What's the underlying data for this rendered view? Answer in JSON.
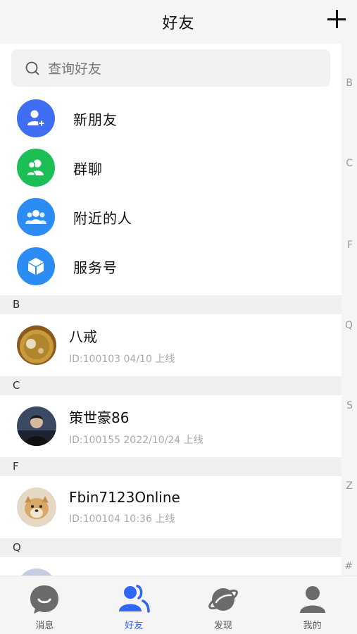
{
  "header": {
    "title": "好友"
  },
  "search": {
    "placeholder": "查询好友"
  },
  "features": [
    {
      "label": "新朋友",
      "color": "#3f6ef2",
      "icon": "add-user-icon"
    },
    {
      "label": "群聊",
      "color": "#1cbf55",
      "icon": "group-icon"
    },
    {
      "label": "附近的人",
      "color": "#2c8cf3",
      "icon": "nearby-people-icon"
    },
    {
      "label": "服务号",
      "color": "#2c8cf3",
      "icon": "cube-icon"
    }
  ],
  "sections": [
    {
      "letter": "B",
      "friend": {
        "name": "八戒",
        "meta": "ID:100103  04/10 上线"
      }
    },
    {
      "letter": "C",
      "friend": {
        "name": "策世豪86",
        "meta": "ID:100155  2022/10/24 上线"
      }
    },
    {
      "letter": "F",
      "friend": {
        "name": "Fbin7123Online",
        "meta": "ID:100104  10:36 上线"
      }
    },
    {
      "letter": "Q"
    }
  ],
  "index_letters": [
    "B",
    "C",
    "F",
    "Q",
    "S",
    "Z",
    "#"
  ],
  "tabs": [
    {
      "label": "消息",
      "icon": "chat-icon"
    },
    {
      "label": "好友",
      "icon": "friends-icon",
      "active": true
    },
    {
      "label": "发现",
      "icon": "planet-icon"
    },
    {
      "label": "我的",
      "icon": "profile-icon"
    }
  ],
  "colors": {
    "accent": "#2f66f6",
    "inactive_icon": "#6b6b6b"
  }
}
